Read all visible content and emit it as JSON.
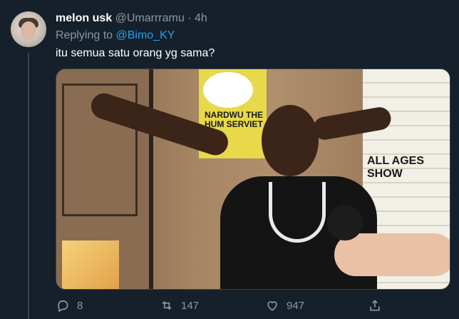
{
  "tweet": {
    "name": "melon usk",
    "handle": "@Umarrramu",
    "separator": "·",
    "time": "4h",
    "replying_prefix": "Replying to",
    "replying_to": "@Bimo_KY",
    "text": "itu semua satu orang yg sama?"
  },
  "media": {
    "poster_text": "NARDWU THE HUM SERVIET",
    "poster2_text": "ALL AGES SHOW"
  },
  "actions": {
    "replies": "8",
    "retweets": "147",
    "likes": "947"
  },
  "colors": {
    "background": "#15202b",
    "text_primary": "#ffffff",
    "text_secondary": "#8899a6",
    "accent": "#1da1f2",
    "divider": "#38444d"
  },
  "icons": {
    "reply": "reply-icon",
    "retweet": "retweet-icon",
    "like": "heart-icon",
    "share": "share-icon"
  }
}
